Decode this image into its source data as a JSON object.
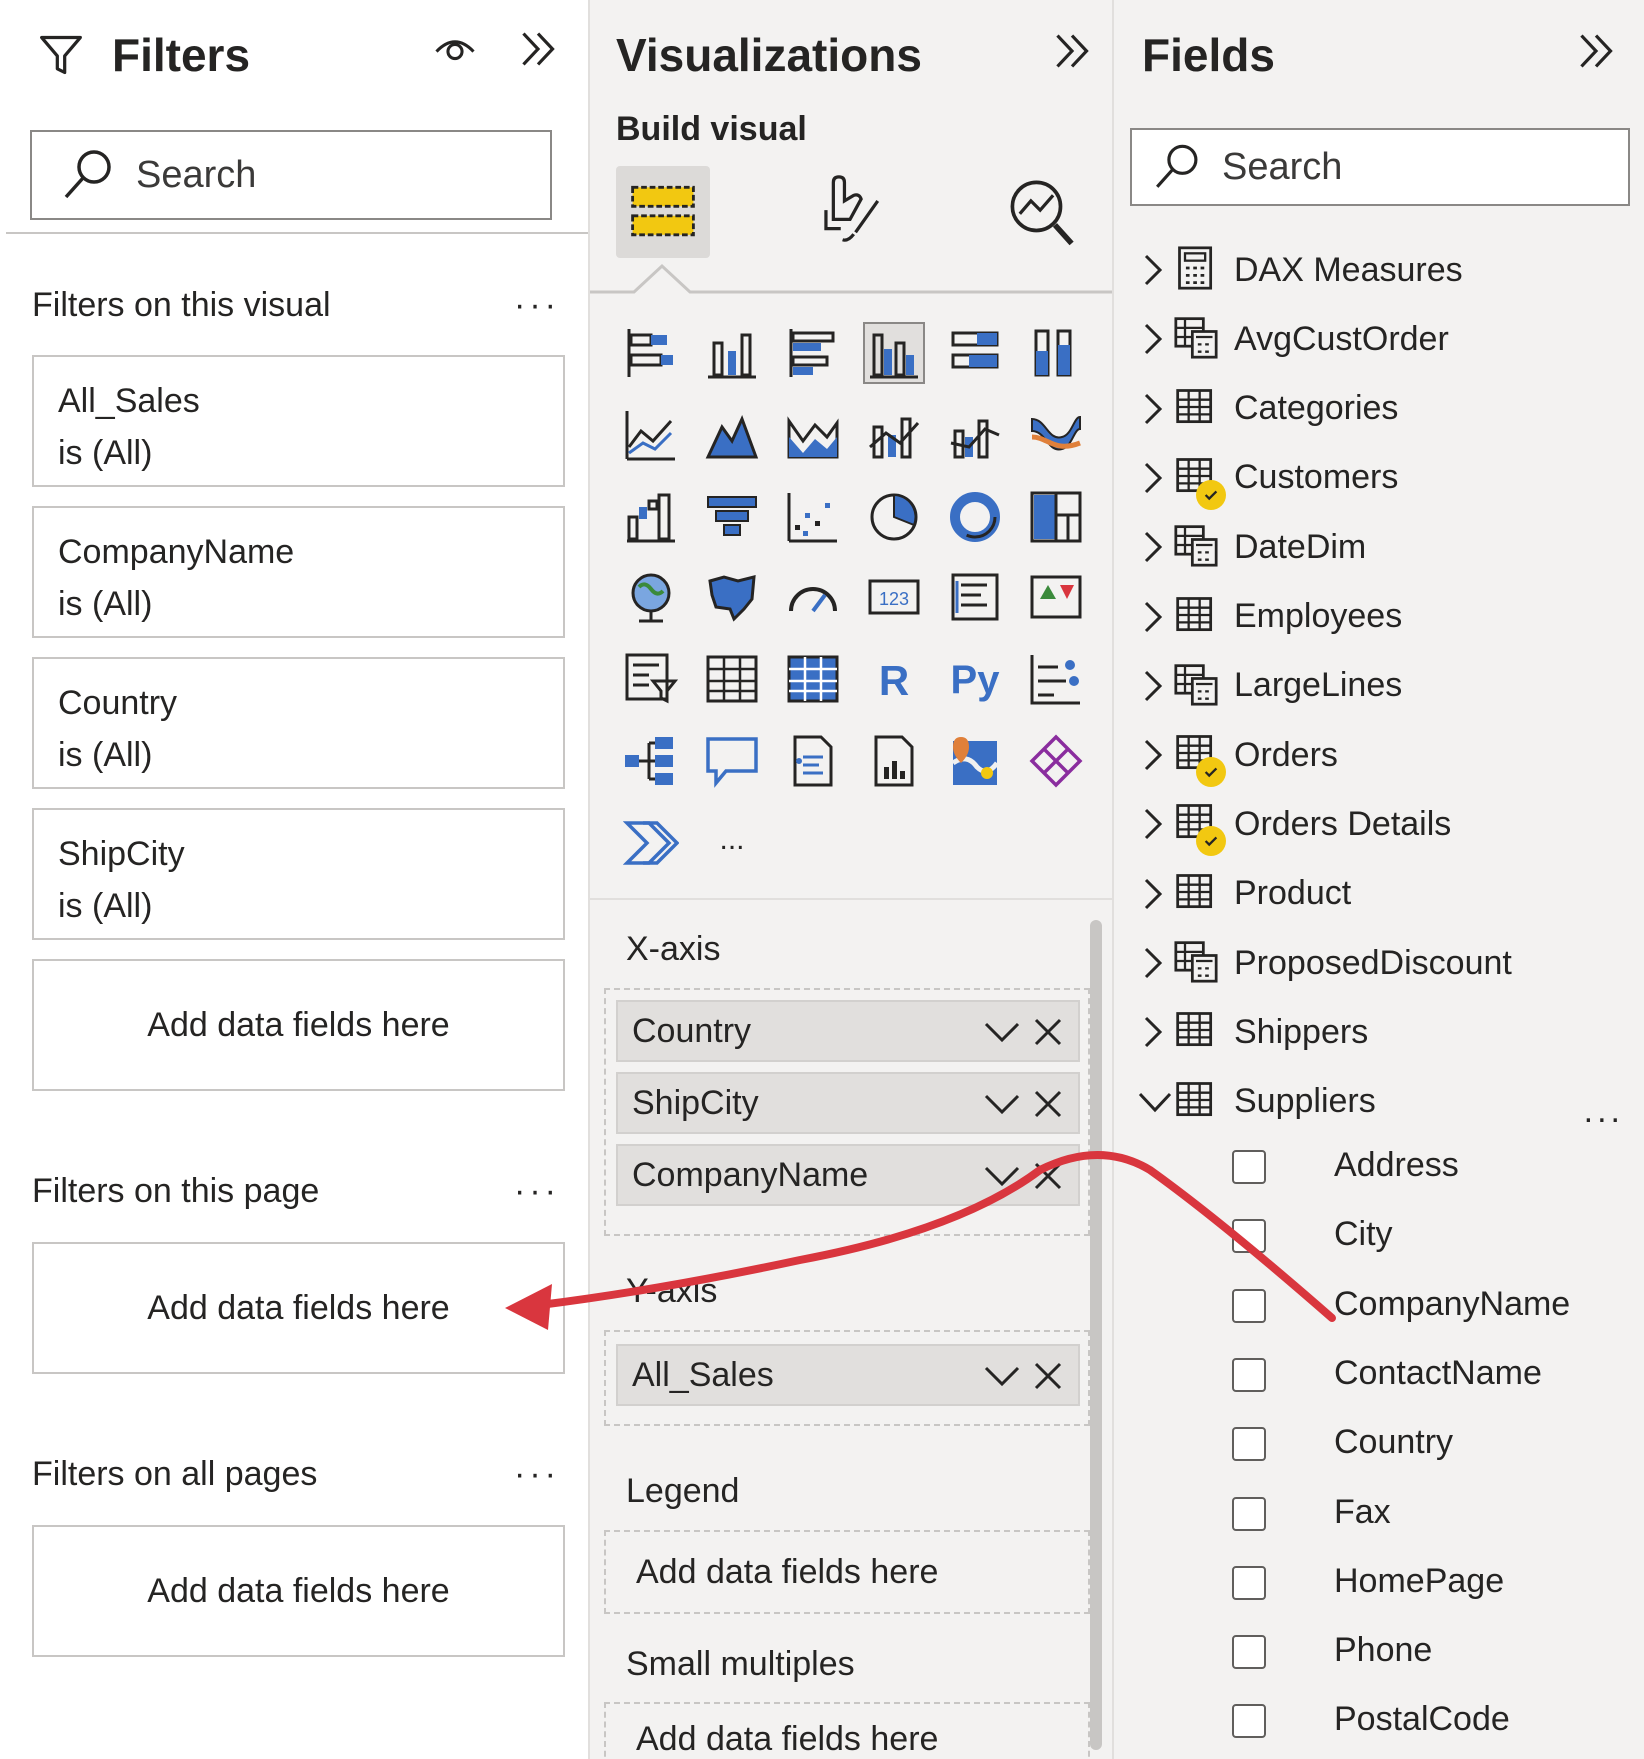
{
  "filters": {
    "title": "Filters",
    "search_placeholder": "Search",
    "visual_section": {
      "label": "Filters on this visual",
      "cards": [
        {
          "field": "All_Sales",
          "condition": "is (All)"
        },
        {
          "field": "CompanyName",
          "condition": "is (All)"
        },
        {
          "field": "Country",
          "condition": "is (All)"
        },
        {
          "field": "ShipCity",
          "condition": "is (All)"
        }
      ],
      "drop_label": "Add data fields here"
    },
    "page_section": {
      "label": "Filters on this page",
      "drop_label": "Add data fields here"
    },
    "all_section": {
      "label": "Filters on all pages",
      "drop_label": "Add data fields here"
    }
  },
  "visualizations": {
    "title": "Visualizations",
    "subtitle": "Build visual",
    "tabs": [
      "build-visual",
      "format-visual",
      "analytics"
    ],
    "icons": [
      "stacked-bar-chart-icon",
      "stacked-column-chart-icon",
      "clustered-bar-chart-icon",
      "clustered-column-chart-icon",
      "100-stacked-bar-chart-icon",
      "100-stacked-column-chart-icon",
      "line-chart-icon",
      "area-chart-icon",
      "stacked-area-chart-icon",
      "line-and-stacked-column-icon",
      "line-and-clustered-column-icon",
      "ribbon-chart-icon",
      "waterfall-chart-icon",
      "funnel-chart-icon",
      "scatter-chart-icon",
      "pie-chart-icon",
      "donut-chart-icon",
      "treemap-icon",
      "map-icon",
      "filled-map-icon",
      "gauge-icon",
      "card-icon",
      "multi-row-card-icon",
      "kpi-icon",
      "slicer-icon",
      "table-icon",
      "matrix-icon",
      "r-visual-icon",
      "python-visual-icon",
      "key-influencers-icon",
      "decomposition-tree-icon",
      "qa-icon",
      "smart-narrative-icon",
      "paginated-report-icon",
      "azure-map-icon",
      "power-apps-icon",
      "power-automate-icon",
      "more-visuals-icon"
    ],
    "r_label": "R",
    "py_label": "Py",
    "card_label": "123",
    "more_label": "...",
    "x_axis": {
      "label": "X-axis",
      "fields": [
        "Country",
        "ShipCity",
        "CompanyName"
      ]
    },
    "y_axis": {
      "label": "Y-axis",
      "fields": [
        "All_Sales"
      ]
    },
    "legend": {
      "label": "Legend",
      "drop_label": "Add data fields here"
    },
    "small_multiples": {
      "label": "Small multiples",
      "drop_label": "Add data fields here"
    }
  },
  "fields": {
    "title": "Fields",
    "search_placeholder": "Search",
    "tables": [
      {
        "name": "DAX Measures",
        "icon": "calculator-icon",
        "checked": false
      },
      {
        "name": "AvgCustOrder",
        "icon": "calculated-table-icon",
        "checked": false
      },
      {
        "name": "Categories",
        "icon": "table-icon",
        "checked": false
      },
      {
        "name": "Customers",
        "icon": "table-icon",
        "checked": true
      },
      {
        "name": "DateDim",
        "icon": "calculated-table-icon",
        "checked": false
      },
      {
        "name": "Employees",
        "icon": "table-icon",
        "checked": false
      },
      {
        "name": "LargeLines",
        "icon": "calculated-table-icon",
        "checked": false
      },
      {
        "name": "Orders",
        "icon": "table-icon",
        "checked": true
      },
      {
        "name": "Orders Details",
        "icon": "table-icon",
        "checked": true
      },
      {
        "name": "Product",
        "icon": "table-icon",
        "checked": false
      },
      {
        "name": "ProposedDiscount",
        "icon": "calculated-table-icon",
        "checked": false
      },
      {
        "name": "Shippers",
        "icon": "table-icon",
        "checked": false
      },
      {
        "name": "Suppliers",
        "icon": "table-icon",
        "checked": false,
        "expanded": true
      }
    ],
    "supplier_columns": [
      "Address",
      "City",
      "CompanyName",
      "ContactName",
      "Country",
      "Fax",
      "HomePage",
      "Phone",
      "PostalCode"
    ],
    "more_label": "..."
  },
  "colors": {
    "accent_yellow": "#f2c811",
    "viz_blue": "#3a6fc4",
    "arrow_red": "#d9363e"
  }
}
